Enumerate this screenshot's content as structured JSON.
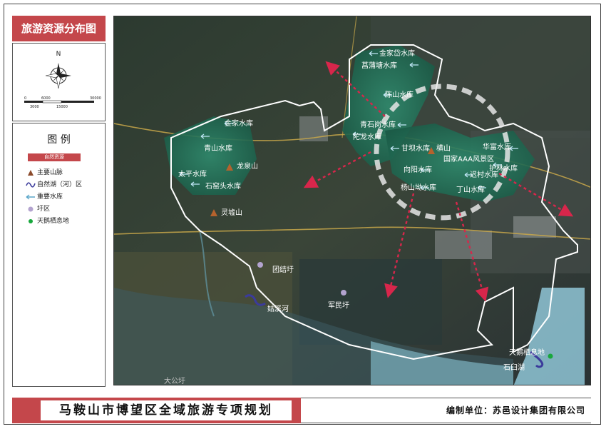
{
  "title": "旅游资源分布图",
  "compass": {
    "north": "N",
    "scale_labels": [
      "0",
      "6000",
      "30000",
      "3000",
      "15000"
    ]
  },
  "legend": {
    "title": "图 例",
    "category": "自然资源",
    "items": [
      {
        "label": "主要山脉",
        "symbol": "mountain-triangle",
        "color": "#8b4a2b"
      },
      {
        "label": "自然湖（河）区",
        "symbol": "lake-squiggle",
        "color": "#3b3b9b"
      },
      {
        "label": "重要水库",
        "symbol": "reservoir-arrow",
        "color": "#5aa6c9"
      },
      {
        "label": "圩区",
        "symbol": "polder-dot",
        "color": "#b3a3cf"
      },
      {
        "label": "天鹅栖息地",
        "symbol": "swan-dot",
        "color": "#18a73c"
      }
    ]
  },
  "map": {
    "reservoirs": [
      "金家岱水库",
      "菖蒲塘水库",
      "陈山水库",
      "金家水库",
      "青山水库",
      "青石岗水库",
      "陀龙水库",
      "甘坝水库",
      "太平水库",
      "石窑头水库",
      "向阳水库",
      "杨山坳水库",
      "华富水库",
      "护林水库",
      "迟村水库",
      "丁山水库"
    ],
    "mountains": [
      "龙泉山",
      "横山",
      "灵墟山"
    ],
    "scenic_area": "国家AAA风景区",
    "polders": [
      "团结圩",
      "军民圩"
    ],
    "lakes": [
      "姑溪河",
      "石臼湖"
    ],
    "swan_habitat": "天鹅栖息地",
    "misc": [
      "大公圩"
    ]
  },
  "footer": {
    "plan_title": "马鞍山市博望区全域旅游专项规划",
    "credit": "编制单位：苏邑设计集团有限公司"
  },
  "colors": {
    "accent": "#c4474b",
    "boundary": "#ffffff",
    "arrows": "#d8264b",
    "forest": "#1e6b55",
    "water": "#8fc6d6"
  }
}
